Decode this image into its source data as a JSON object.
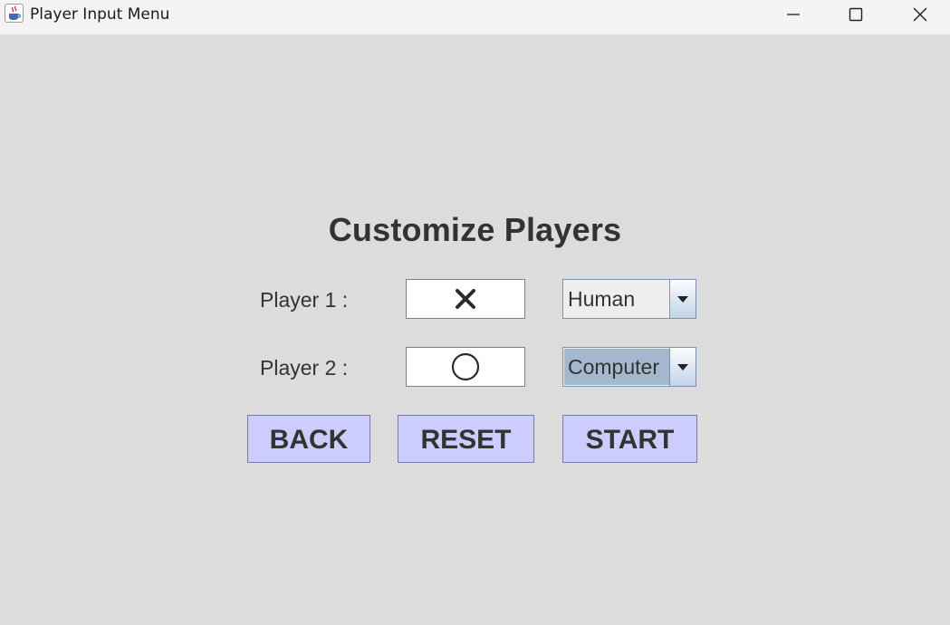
{
  "window": {
    "title": "Player Input Menu",
    "icon": "java-coffee-cup-icon",
    "controls": [
      "minimize-icon",
      "maximize-icon",
      "close-icon"
    ]
  },
  "main": {
    "heading": "Customize Players",
    "players": [
      {
        "label": "Player 1 :",
        "symbol": "X",
        "type": "Human",
        "type_selected_highlight": false
      },
      {
        "label": "Player 2 :",
        "symbol": "O",
        "type": "Computer",
        "type_selected_highlight": true
      }
    ],
    "buttons": {
      "back": "BACK",
      "reset": "RESET",
      "start": "START"
    }
  },
  "colors": {
    "background": "#dcdcdc",
    "button_fill": "#ccccff",
    "combo_highlight": "#a3b8cc",
    "text": "#333333"
  }
}
